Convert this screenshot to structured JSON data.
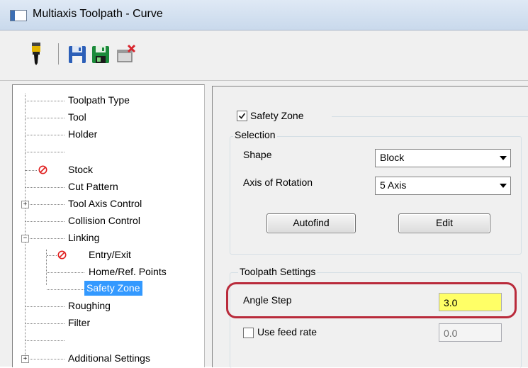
{
  "window": {
    "title": "Multiaxis Toolpath - Curve"
  },
  "toolbar": {
    "icons": [
      "tool-icon",
      "save-icon",
      "save-default-icon",
      "cancel-icon"
    ]
  },
  "tree": {
    "items": [
      {
        "label": "Toolpath Type"
      },
      {
        "label": "Tool"
      },
      {
        "label": "Holder"
      },
      {
        "label": ""
      },
      {
        "label": "Stock"
      },
      {
        "label": "Cut Pattern"
      },
      {
        "label": "Tool Axis Control"
      },
      {
        "label": "Collision Control"
      },
      {
        "label": "Linking"
      },
      {
        "label": "Entry/Exit"
      },
      {
        "label": "Home/Ref. Points"
      },
      {
        "label": "Safety Zone"
      },
      {
        "label": "Roughing"
      },
      {
        "label": "Filter"
      },
      {
        "label": ""
      },
      {
        "label": "Additional Settings"
      }
    ],
    "selected": "Safety Zone",
    "colors": {
      "selection": "#3399ff",
      "disabled_icon": "#e02020"
    }
  },
  "safety_zone": {
    "checkbox_label": "Safety Zone",
    "checked": true,
    "selection_group": {
      "title": "Selection",
      "shape_label": "Shape",
      "shape_value": "Block",
      "axis_label": "Axis of Rotation",
      "axis_value": "5 Axis",
      "autofind_label": "Autofind",
      "edit_label": "Edit"
    },
    "toolpath_settings": {
      "title": "Toolpath Settings",
      "angle_step_label": "Angle Step",
      "angle_step_value": "3.0",
      "use_feed_rate_label": "Use feed rate",
      "use_feed_rate_checked": false,
      "feed_rate_value": "0.0"
    }
  },
  "colors": {
    "angle_highlight": "#ffff66",
    "callout_ring": "#b92b3b"
  }
}
